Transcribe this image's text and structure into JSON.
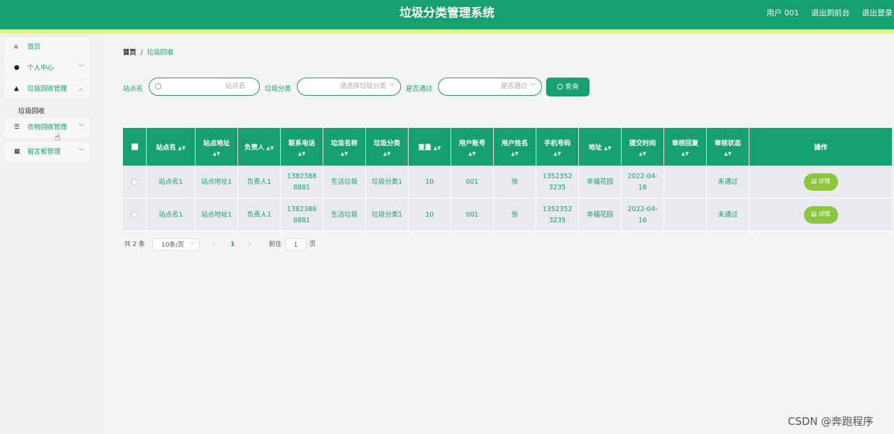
{
  "header": {
    "title": "垃圾分类管理系统",
    "user": "用户 001",
    "back_to_front": "退出到前台",
    "logout": "退出登录"
  },
  "sidebar": {
    "items": [
      {
        "label": "首页",
        "icon": "home-icon"
      },
      {
        "label": "个人中心",
        "icon": "user-icon"
      },
      {
        "label": "垃圾回收管理",
        "icon": "person-icon"
      },
      {
        "label": "衣物回收管理",
        "icon": "list-icon"
      },
      {
        "label": "留言板管理",
        "icon": "grid-icon"
      }
    ],
    "submenu": "垃圾回收"
  },
  "breadcrumb": {
    "home": "首页",
    "separator": "/",
    "current": "垃圾回收"
  },
  "filters": {
    "station_label": "站点名",
    "station_placeholder": "站点名",
    "category_label": "垃圾分类",
    "category_placeholder": "请选择垃圾分类",
    "pass_label": "是否通过",
    "pass_placeholder": "是否通过",
    "query_label": "查询"
  },
  "table": {
    "headers": [
      "站点名",
      "站点地址",
      "负责人",
      "联系电话",
      "垃圾名称",
      "垃圾分类",
      "重量",
      "用户账号",
      "用户姓名",
      "手机号码",
      "地址",
      "提交时间",
      "审核回复",
      "审核状态",
      "操作"
    ],
    "rows": [
      {
        "station": "站点名1",
        "address": "站点地址1",
        "manager": "负责人1",
        "phone": "13823888881",
        "name": "生活垃圾",
        "category": "垃圾分类1",
        "weight": "10",
        "account": "001",
        "username": "张",
        "mobile": "13523523235",
        "addr": "幸福花园",
        "time": "2022-04-16",
        "reply": "",
        "status": "未通过",
        "action": "详情"
      },
      {
        "station": "站点名1",
        "address": "站点地址1",
        "manager": "负责人1",
        "phone": "13823888881",
        "name": "生活垃圾",
        "category": "垃圾分类1",
        "weight": "10",
        "account": "001",
        "username": "张",
        "mobile": "13523523235",
        "addr": "幸福花园",
        "time": "2022-04-16",
        "reply": "",
        "status": "未通过",
        "action": "详情"
      }
    ]
  },
  "pagination": {
    "total": "共 2 条",
    "page_size": "10条/页",
    "prev": "‹",
    "current": "1",
    "next": "›",
    "goto_label": "前往",
    "goto_value": "1",
    "page_unit": "页"
  },
  "colors": {
    "primary": "#16a070",
    "accent_bar": "#e8f078",
    "detail_button": "#8cc63e"
  },
  "watermark": "CSDN @奔跑程序"
}
